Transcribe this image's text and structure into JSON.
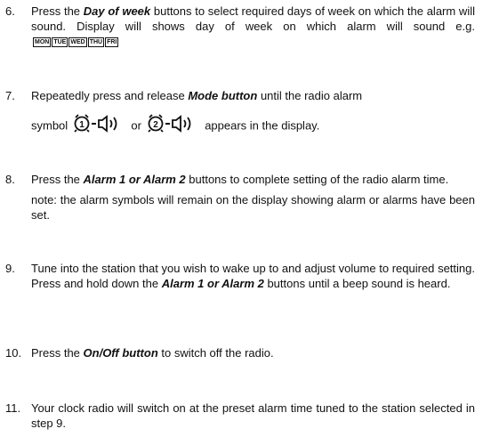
{
  "steps": [
    {
      "num": "6.",
      "pre": "Press the ",
      "em": "Day of week",
      "post": " buttons to select required days of week on which the alarm will sound. Display will shows day of week on which alarm will sound e.g. ",
      "days": [
        "MON",
        "TUE",
        "WED",
        "THU",
        "FRI"
      ]
    },
    {
      "num": "7.",
      "pre": "Repeatedly press and release ",
      "em": "Mode button",
      "post": " until the radio alarm",
      "line2_pre": "symbol ",
      "line2_mid": " or ",
      "line2_post": " appears in the display.",
      "symbol_icons": [
        "alarm1-radio-icon",
        "alarm2-radio-icon"
      ]
    },
    {
      "num": "8.",
      "pre": "Press the ",
      "em": "Alarm 1 or Alarm 2",
      "post": " buttons to complete setting of the radio alarm time.",
      "note": "note: the alarm symbols will remain on the display showing alarm or alarms have been set."
    },
    {
      "num": "9.",
      "pre": "Tune into the station that you wish to wake up to and adjust volume to required setting. Press and hold down the ",
      "em": "Alarm 1 or Alarm 2",
      "post": " buttons until a beep sound is heard."
    },
    {
      "num": "10.",
      "pre": "Press the ",
      "em": "On/Off button",
      "post": " to switch off the radio."
    },
    {
      "num": "11.",
      "pre": "Your clock radio will switch on at the preset alarm time tuned to the station selected in step 9."
    }
  ]
}
